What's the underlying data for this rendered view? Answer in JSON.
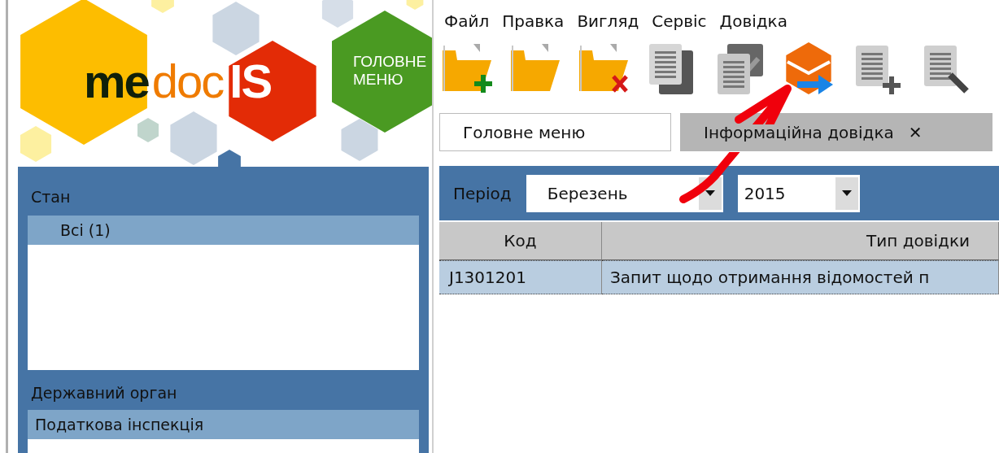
{
  "logo": {
    "parts": [
      "me",
      "doc",
      "IS"
    ]
  },
  "main_menu_button": {
    "lines": [
      "ГОЛОВНЕ",
      "МЕНЮ"
    ]
  },
  "sidebar": {
    "sections": [
      {
        "title": "Стан",
        "items": [
          {
            "label": "Всі (1)",
            "selected": true
          }
        ]
      },
      {
        "title": "Державний орган",
        "items": [
          {
            "label": "Податкова інспекція",
            "selected": true
          }
        ]
      }
    ]
  },
  "menu": [
    "Файл",
    "Правка",
    "Вигляд",
    "Сервіс",
    "Довідка"
  ],
  "toolbar": [
    {
      "kind": "folder-add"
    },
    {
      "kind": "folder"
    },
    {
      "kind": "folder-delete"
    },
    {
      "kind": "copy"
    },
    {
      "kind": "copy-edit"
    },
    {
      "kind": "send"
    },
    {
      "kind": "doc-add"
    },
    {
      "kind": "doc-edit"
    }
  ],
  "tabs": [
    {
      "label": "Головне меню",
      "selected": false
    },
    {
      "label": "Інформаційна довідка",
      "selected": true,
      "close": "✕"
    }
  ],
  "filter": {
    "label": "Період",
    "month": {
      "value": "Березень"
    },
    "year": {
      "value": "2015"
    }
  },
  "table": {
    "columns": [
      "Код",
      "Тип довідки"
    ],
    "rows": [
      {
        "cells": [
          "J1301201",
          "Запит щодо отримання відомостей п"
        ],
        "selected": true
      }
    ]
  }
}
